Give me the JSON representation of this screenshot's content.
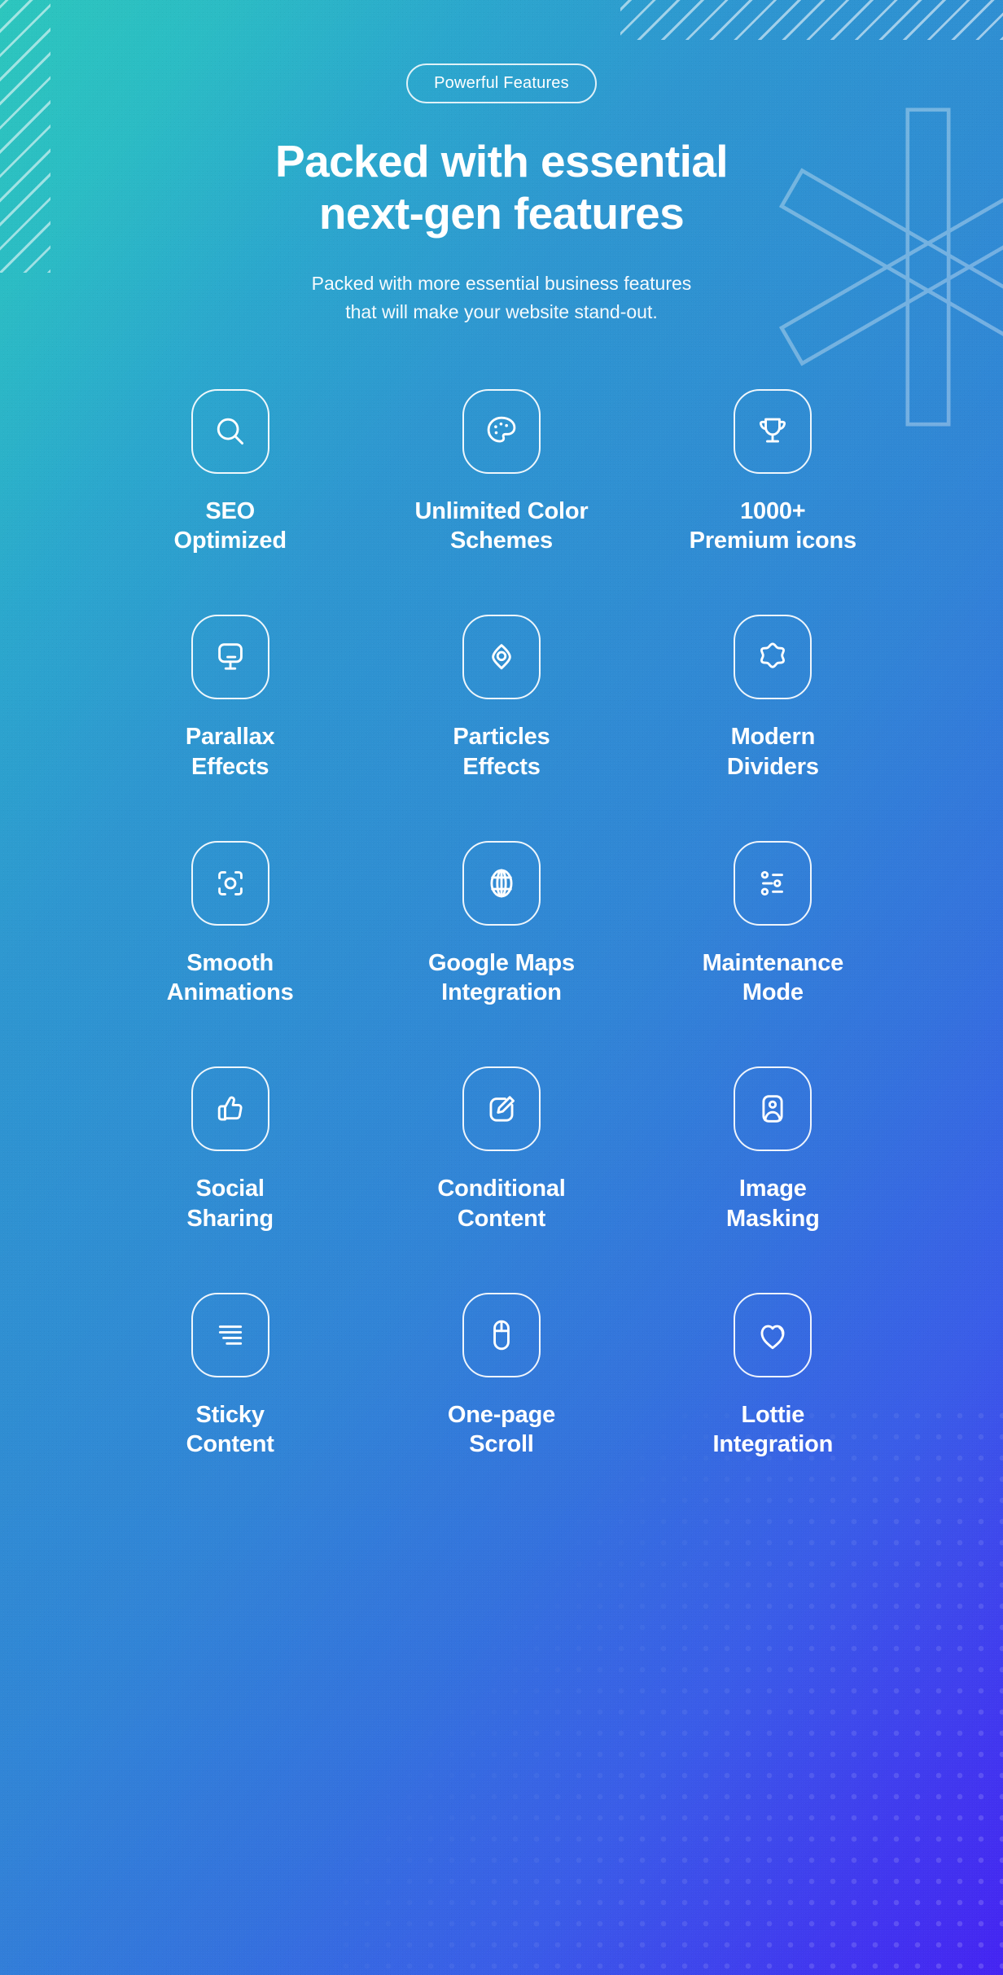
{
  "header": {
    "badge_label": "Powerful Features",
    "headline_line1": "Packed with essential",
    "headline_line2": "next-gen features",
    "subtitle_line1": "Packed with more essential business features",
    "subtitle_line2": "that will make your website stand-out."
  },
  "colors": {
    "gradient_start": "#2cc6bd",
    "gradient_mid": "#3184d6",
    "gradient_end": "#4524f2",
    "text": "#ffffff"
  },
  "features": [
    {
      "label": "SEO\nOptimized",
      "label_line1": "SEO",
      "label_line2": "Optimized",
      "icon": "search-icon"
    },
    {
      "label": "Unlimited Color\nSchemes",
      "label_line1": "Unlimited Color",
      "label_line2": "Schemes",
      "icon": "palette-icon"
    },
    {
      "label": "1000+\nPremium icons",
      "label_line1": "1000+",
      "label_line2": "Premium icons",
      "icon": "trophy-icon"
    },
    {
      "label": "Parallax\nEffects",
      "label_line1": "Parallax",
      "label_line2": "Effects",
      "icon": "monitor-icon"
    },
    {
      "label": "Particles\nEffects",
      "label_line1": "Particles",
      "label_line2": "Effects",
      "icon": "eye-icon"
    },
    {
      "label": "Modern\nDividers",
      "label_line1": "Modern",
      "label_line2": "Dividers",
      "icon": "blob-star-icon"
    },
    {
      "label": "Smooth\nAnimations",
      "label_line1": "Smooth",
      "label_line2": "Animations",
      "icon": "focus-scan-icon"
    },
    {
      "label": "Google Maps\nIntegration",
      "label_line1": "Google Maps",
      "label_line2": "Integration",
      "icon": "globe-icon"
    },
    {
      "label": "Maintenance\nMode",
      "label_line1": "Maintenance",
      "label_line2": "Mode",
      "icon": "settings-list-icon"
    },
    {
      "label": "Social\nSharing",
      "label_line1": "Social",
      "label_line2": "Sharing",
      "icon": "thumbs-up-icon"
    },
    {
      "label": "Conditional\nContent",
      "label_line1": "Conditional",
      "label_line2": "Content",
      "icon": "edit-pencil-icon"
    },
    {
      "label": "Image\nMasking",
      "label_line1": "Image",
      "label_line2": "Masking",
      "icon": "image-person-icon"
    },
    {
      "label": "Sticky\nContent",
      "label_line1": "Sticky",
      "label_line2": "Content",
      "icon": "text-lines-icon"
    },
    {
      "label": "One-page\nScroll",
      "label_line1": "One-page",
      "label_line2": "Scroll",
      "icon": "mouse-icon"
    },
    {
      "label": "Lottie\nIntegration",
      "label_line1": "Lottie",
      "label_line2": "Integration",
      "icon": "heart-icon"
    }
  ],
  "decorations": {
    "stripes_left": "diagonal-stripes",
    "stripes_right": "diagonal-stripes",
    "asterisk": "asterisk-outline",
    "dots": "halftone-dots"
  }
}
